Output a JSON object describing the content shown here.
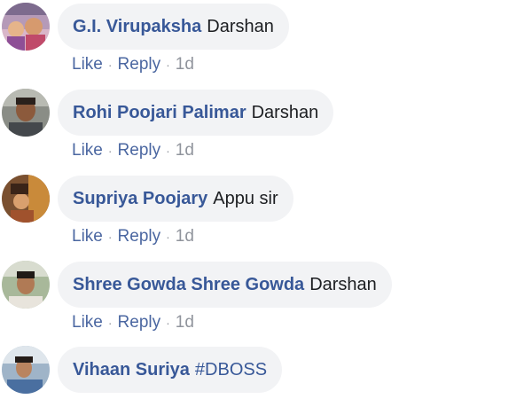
{
  "comments": [
    {
      "author": "G.I. Virupaksha",
      "text": "Darshan",
      "like_label": "Like",
      "reply_label": "Reply",
      "time": "1d"
    },
    {
      "author": "Rohi Poojari Palimar",
      "text": "Darshan",
      "like_label": "Like",
      "reply_label": "Reply",
      "time": "1d"
    },
    {
      "author": "Supriya Poojary",
      "text": "Appu sir",
      "like_label": "Like",
      "reply_label": "Reply",
      "time": "1d"
    },
    {
      "author": "Shree Gowda Shree Gowda",
      "text": "Darshan",
      "like_label": "Like",
      "reply_label": "Reply",
      "time": "1d"
    },
    {
      "author": "Vihaan Suriya",
      "text": "#DBOSS"
    }
  ],
  "separator": "·",
  "colors": {
    "author": "#385898",
    "action": "#4b67a1",
    "muted": "#90949c",
    "bubble": "#f2f3f5",
    "text": "#1c1e21"
  }
}
